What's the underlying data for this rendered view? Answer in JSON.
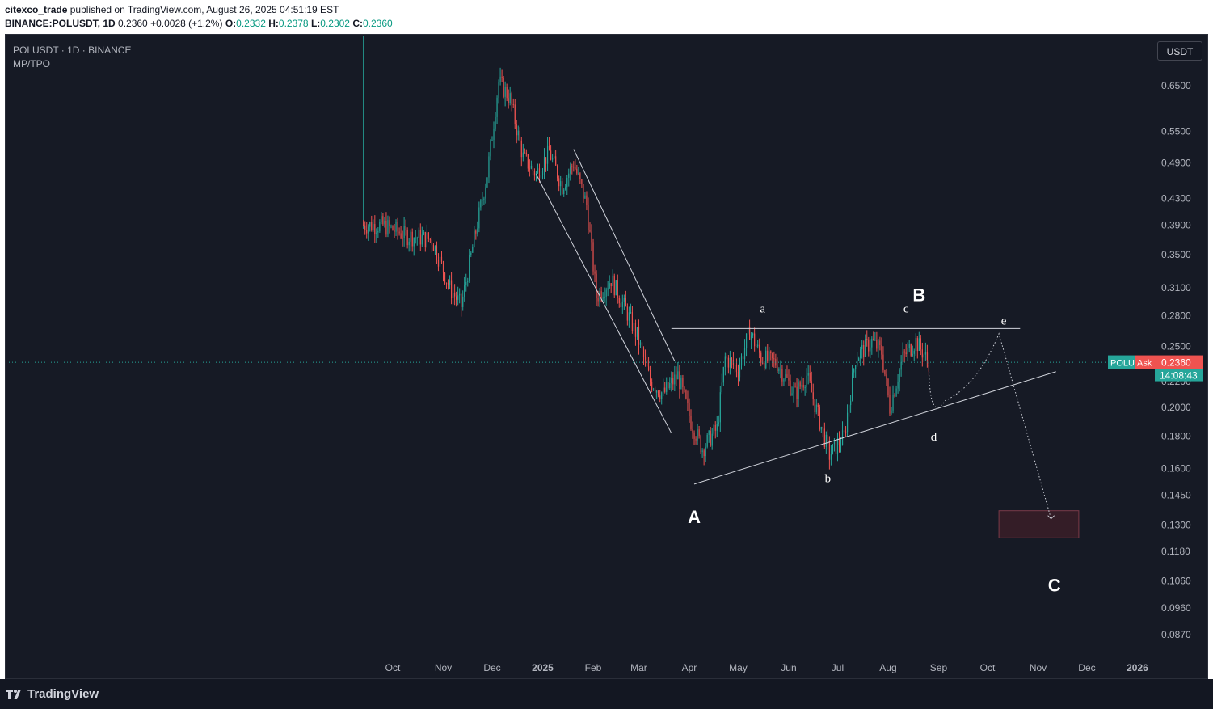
{
  "header": {
    "author": "citexco_trade",
    "published": "published on TradingView.com, August 26, 2025 04:51:19 EST",
    "symbol_line": "BINANCE:POLUSDT, 1D",
    "last": "0.2360",
    "change": "+0.0028 (+1.2%)",
    "o_label": "O:",
    "o_val": "0.2332",
    "h_label": "H:",
    "h_val": "0.2378",
    "l_label": "L:",
    "l_val": "0.2302",
    "c_label": "C:",
    "c_val": "0.2360"
  },
  "legend": {
    "title": "POLUSDT · 1D · BINANCE",
    "indicator": "MP/TPO"
  },
  "currency_button": "USDT",
  "price_tag": {
    "symbol": "POLU",
    "ask": "Ask",
    "price": "0.2360",
    "countdown": "14:08:43"
  },
  "footer": {
    "brand": "TradingView"
  },
  "colors": {
    "up": "#26a69a",
    "down": "#ef5350",
    "background": "#161a25",
    "lines": "#d1d4dc",
    "target_box": "#4a1f2a"
  },
  "chart_data": {
    "type": "candlestick",
    "y_scale": "log",
    "y_ticks": [
      "0.6500",
      "0.5500",
      "0.4900",
      "0.4300",
      "0.3900",
      "0.3500",
      "0.3100",
      "0.2800",
      "0.2500",
      "0.2200",
      "0.2000",
      "0.1800",
      "0.1600",
      "0.1450",
      "0.1300",
      "0.1180",
      "0.1060",
      "0.0960",
      "0.0870"
    ],
    "x_ticks": [
      "Oct",
      "Nov",
      "Dec",
      "2025",
      "Feb",
      "Mar",
      "Apr",
      "May",
      "Jun",
      "Jul",
      "Aug",
      "Sep",
      "Oct",
      "Nov",
      "Dec",
      "2026"
    ],
    "last_price": 0.236,
    "series_control": [
      [
        "2024-09-13",
        0.39
      ],
      [
        "2024-09-25",
        0.39
      ],
      [
        "2024-10-10",
        0.375
      ],
      [
        "2024-10-25",
        0.37
      ],
      [
        "2024-11-05",
        0.31
      ],
      [
        "2024-11-12",
        0.29
      ],
      [
        "2024-11-20",
        0.37
      ],
      [
        "2024-11-28",
        0.47
      ],
      [
        "2024-12-05",
        0.66
      ],
      [
        "2024-12-12",
        0.62
      ],
      [
        "2024-12-20",
        0.5
      ],
      [
        "2024-12-28",
        0.47
      ],
      [
        "2025-01-05",
        0.51
      ],
      [
        "2025-01-13",
        0.45
      ],
      [
        "2025-01-20",
        0.49
      ],
      [
        "2025-01-28",
        0.42
      ],
      [
        "2025-02-03",
        0.3
      ],
      [
        "2025-02-12",
        0.32
      ],
      [
        "2025-02-20",
        0.29
      ],
      [
        "2025-02-28",
        0.26
      ],
      [
        "2025-03-08",
        0.22
      ],
      [
        "2025-03-16",
        0.21
      ],
      [
        "2025-03-25",
        0.225
      ],
      [
        "2025-04-02",
        0.19
      ],
      [
        "2025-04-09",
        0.172
      ],
      [
        "2025-04-18",
        0.185
      ],
      [
        "2025-04-23",
        0.24
      ],
      [
        "2025-05-01",
        0.23
      ],
      [
        "2025-05-08",
        0.265
      ],
      [
        "2025-05-15",
        0.24
      ],
      [
        "2025-05-25",
        0.235
      ],
      [
        "2025-06-05",
        0.21
      ],
      [
        "2025-06-12",
        0.225
      ],
      [
        "2025-06-20",
        0.19
      ],
      [
        "2025-06-26",
        0.168
      ],
      [
        "2025-07-05",
        0.18
      ],
      [
        "2025-07-12",
        0.24
      ],
      [
        "2025-07-22",
        0.255
      ],
      [
        "2025-07-28",
        0.245
      ],
      [
        "2025-08-02",
        0.2
      ],
      [
        "2025-08-10",
        0.24
      ],
      [
        "2025-08-18",
        0.255
      ],
      [
        "2025-08-26",
        0.236
      ]
    ],
    "trendlines": [
      {
        "from": [
          "2025-01-20",
          0.515
        ],
        "to": [
          "2025-03-23",
          0.237
        ]
      },
      {
        "from": [
          "2024-12-28",
          0.47
        ],
        "to": [
          "2025-03-21",
          0.182
        ]
      },
      {
        "from": [
          "2025-03-21",
          0.267
        ],
        "to": [
          "2025-10-21",
          0.267
        ]
      },
      {
        "from": [
          "2025-04-04",
          0.151
        ],
        "to": [
          "2025-11-12",
          0.228
        ]
      }
    ],
    "projection": [
      [
        "2025-08-26",
        0.236
      ],
      [
        "2025-09-05",
        0.205
      ],
      [
        "2025-09-20",
        0.22
      ],
      [
        "2025-10-08",
        0.262
      ],
      [
        "2025-11-09",
        0.133
      ]
    ],
    "target_zone": {
      "x0": "2025-10-08",
      "x1": "2025-11-26",
      "y0": 0.124,
      "y1": 0.137
    },
    "wave_labels": [
      {
        "text": "A",
        "x": "2025-04-04",
        "y": 0.131,
        "major": true
      },
      {
        "text": "B",
        "x": "2025-08-20",
        "y": 0.295,
        "major": true
      },
      {
        "text": "C",
        "x": "2025-11-11",
        "y": 0.102,
        "major": true
      },
      {
        "text": "a",
        "x": "2025-05-16",
        "y": 0.283,
        "major": false
      },
      {
        "text": "b",
        "x": "2025-06-25",
        "y": 0.152,
        "major": false
      },
      {
        "text": "c",
        "x": "2025-08-12",
        "y": 0.283,
        "major": false
      },
      {
        "text": "d",
        "x": "2025-08-29",
        "y": 0.177,
        "major": false
      },
      {
        "text": "e",
        "x": "2025-10-11",
        "y": 0.271,
        "major": false
      }
    ]
  }
}
